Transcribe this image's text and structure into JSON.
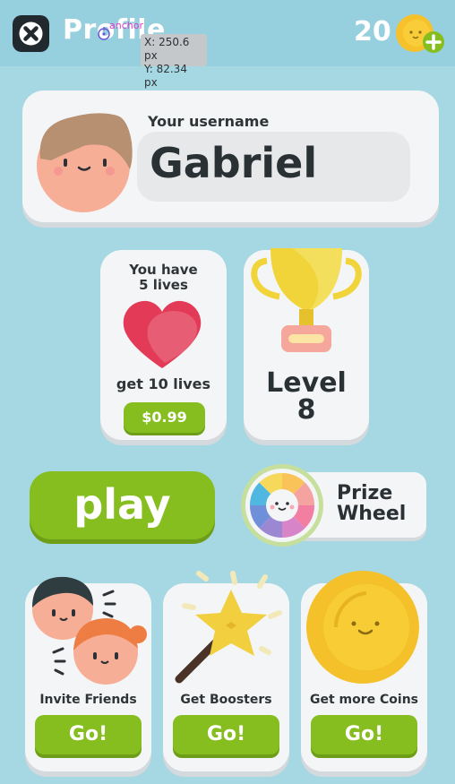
{
  "header": {
    "title": "Profile",
    "coins": "20",
    "anchor_label": "anchor",
    "tooltip": {
      "x": "X: 250.6 px",
      "y": "Y: 82.34 px"
    }
  },
  "profile": {
    "username_label": "Your username",
    "username": "Gabriel"
  },
  "lives": {
    "title_line1": "You have",
    "title_line2": "5 lives",
    "offer": "get 10 lives",
    "price": "$0.99"
  },
  "level": {
    "label": "Level",
    "value": "8"
  },
  "play": {
    "label": "play"
  },
  "prize_wheel": {
    "line1": "Prize",
    "line2": "Wheel"
  },
  "actions": [
    {
      "label": "Invite Friends",
      "button": "Go!"
    },
    {
      "label": "Get Boosters",
      "button": "Go!"
    },
    {
      "label": "Get more Coins",
      "button": "Go!"
    }
  ],
  "colors": {
    "background": "#a6d8e4",
    "accent_green": "#86be1f",
    "coin_gold": "#f6c12a",
    "heart_red": "#e23a57",
    "card": "#f4f5f6"
  },
  "icons": [
    "close-icon",
    "anchor-icon",
    "coin-icon",
    "plus-icon",
    "avatar-icon",
    "heart-icon",
    "trophy-icon",
    "prize-wheel-icon",
    "friends-icon",
    "magic-wand-icon",
    "big-coin-icon"
  ]
}
